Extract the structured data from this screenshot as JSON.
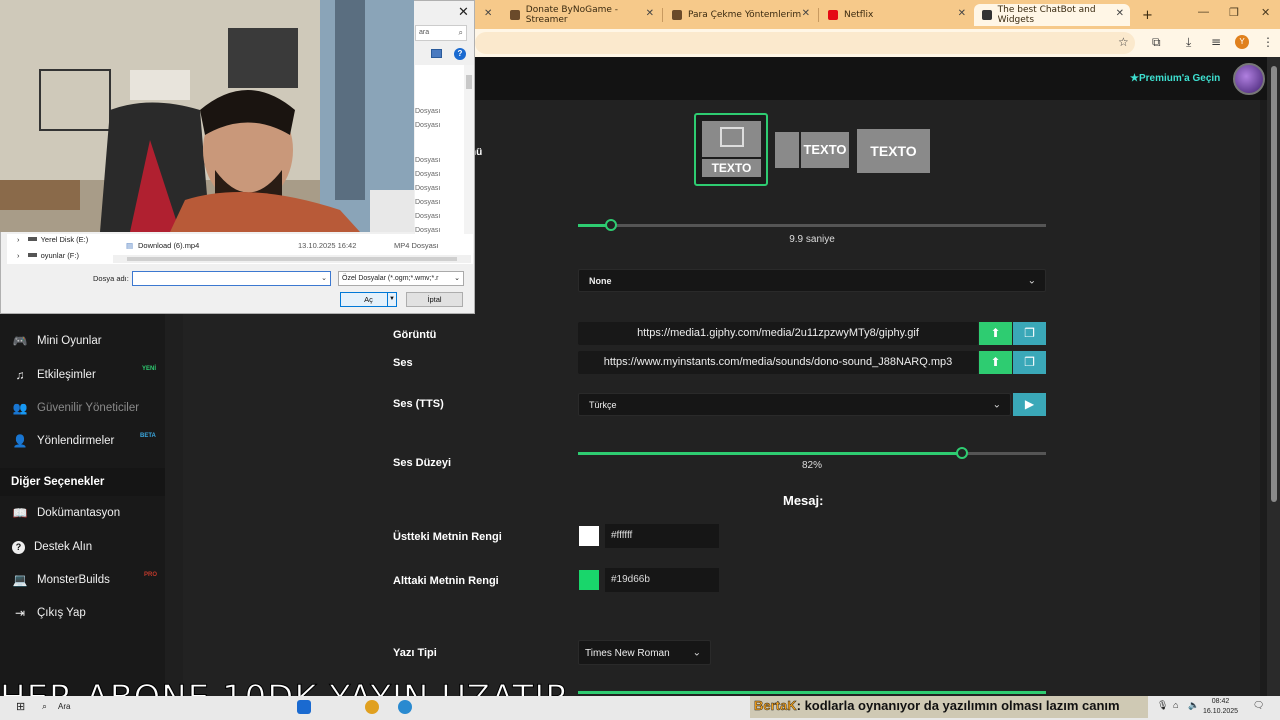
{
  "browser": {
    "tabs": [
      {
        "title": "Donate ByNoGame - Streamer",
        "active": false
      },
      {
        "title": "Para Çekme Yöntemlerim",
        "active": false
      },
      {
        "title": "Netflix",
        "active": false
      },
      {
        "title": "The best ChatBot and Widgets",
        "active": true
      }
    ],
    "new_tab": "+",
    "profile_initial": "Y"
  },
  "header": {
    "premium_label": "Premium'a Geçin"
  },
  "sidebar": {
    "items": [
      {
        "label": "Mini Oyunlar",
        "icon": "gamepad-icon",
        "glyph": "🎮",
        "badge": ""
      },
      {
        "label": "Etkileşimler",
        "icon": "music-icon",
        "glyph": "♫",
        "badge": "YENİ"
      },
      {
        "label": "Güvenilir Yöneticiler",
        "icon": "users-icon",
        "glyph": "👥",
        "badge": ""
      },
      {
        "label": "Yönlendirmeler",
        "icon": "user-plus-icon",
        "glyph": "👤",
        "badge": "BETA"
      }
    ],
    "section_title": "Diğer Seçenekler",
    "other_items": [
      {
        "label": "Dokümantasyon",
        "icon": "book-icon",
        "glyph": "📖",
        "badge": ""
      },
      {
        "label": "Destek Alın",
        "icon": "question-icon",
        "glyph": "?",
        "badge": ""
      },
      {
        "label": "MonsterBuilds",
        "icon": "laptop-icon",
        "glyph": "💻",
        "badge": "PRO"
      },
      {
        "label": "Çıkış Yap",
        "icon": "logout-icon",
        "glyph": "⇥",
        "badge": ""
      }
    ]
  },
  "file_dialog": {
    "search_placeholder": "ara",
    "list_type_labels": [
      "Dosyası",
      "Dosyası",
      "Dosyası",
      "Dosyası",
      "Dosyası",
      "Dosyası",
      "Dosyası",
      "Dosyası",
      "Dosyası"
    ],
    "tree": [
      "Yerel Disk (E:)",
      "oyunlar (F:)"
    ],
    "file": {
      "name": "Download (6).mp4",
      "date": "13.10.2025 16:42",
      "type": "MP4 Dosyası"
    },
    "filename_label": "Dosya adı:",
    "filename_value": "",
    "filter": "Özel Dosyalar (*.ogm;*.wmv;*.r",
    "open_button": "Aç",
    "cancel_button": "İptal"
  },
  "form": {
    "partial_label": "nü",
    "layout_options": [
      {
        "caption": "TEXTO",
        "selected": true
      },
      {
        "caption": "TEXTO",
        "selected": false
      },
      {
        "caption": "TEXTO",
        "selected": false
      }
    ],
    "duration": {
      "value_text": "9.9 saniye",
      "fraction": 0.07
    },
    "animation_select": "None",
    "image_label": "Görüntü",
    "image_url": "https://media1.giphy.com/media/2u11zpzwyMTy8/giphy.gif",
    "sound_label": "Ses",
    "sound_url": "https://www.myinstants.com/media/sounds/dono-sound_J88NARQ.mp3",
    "tts_label": "Ses (TTS)",
    "tts_language": "Türkçe",
    "volume_label": "Ses Düzeyi",
    "volume": {
      "value_text": "82%",
      "fraction": 0.82
    },
    "message_heading": "Mesaj:",
    "top_text_color_label": "Üstteki Metnin Rengi",
    "top_text_color": "#ffffff",
    "bottom_text_color_label": "Alttaki Metnin Rengi",
    "bottom_text_color": "#19d66b",
    "font_label": "Yazı Tipi",
    "font_value": "Times New Roman"
  },
  "colors": {
    "accent_green": "#2ecc71",
    "upload_green": "#2ecc71",
    "gallery_teal": "#3aa8b8",
    "premium_cyan": "#3ee0d0"
  },
  "overlay": {
    "stream_text": "HER ABONE 10DK YAYIN UZATIR",
    "chat_user": "BertaK",
    "chat_message": ": kodlarla oynanıyor da yazılımın olması lazım canım"
  },
  "taskbar": {
    "search_text": "Ara",
    "time": "08:42",
    "date": "16.10.2025"
  }
}
